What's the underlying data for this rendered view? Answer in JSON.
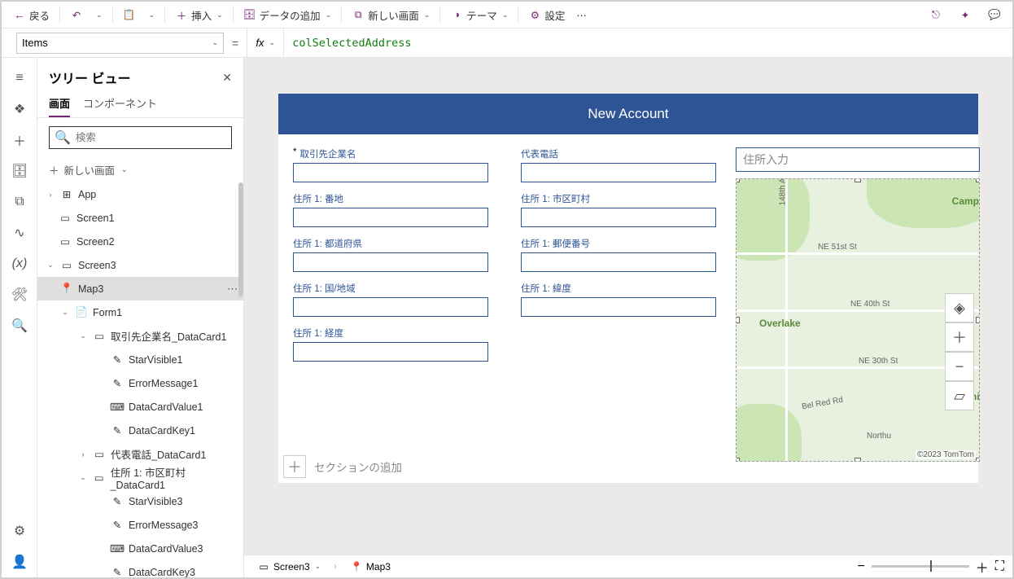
{
  "topbar": {
    "back": "戻る",
    "insert": "挿入",
    "add_data": "データの追加",
    "new_screen": "新しい画面",
    "theme": "テーマ",
    "settings": "設定"
  },
  "formula": {
    "property": "Items",
    "fx": "fx",
    "expression": "colSelectedAddress"
  },
  "tree": {
    "title": "ツリー ビュー",
    "tab_screen": "画面",
    "tab_components": "コンポーネント",
    "search_placeholder": "検索",
    "new_screen": "新しい画面",
    "items": {
      "app": "App",
      "screen1": "Screen1",
      "screen2": "Screen2",
      "screen3": "Screen3",
      "map3": "Map3",
      "form1": "Form1",
      "dc_company": "取引先企業名_DataCard1",
      "starvisible1": "StarVisible1",
      "errormessage1": "ErrorMessage1",
      "datacardvalue1": "DataCardValue1",
      "datacardkey1": "DataCardKey1",
      "dc_phone": "代表電話_DataCard1",
      "dc_city": "住所 1: 市区町村_DataCard1",
      "starvisible3": "StarVisible3",
      "errormessage3": "ErrorMessage3",
      "datacardvalue3": "DataCardValue3",
      "datacardkey3": "DataCardKey3"
    }
  },
  "screen": {
    "title": "New Account",
    "fields": {
      "company": "取引先企業名",
      "phone": "代表電話",
      "street": "住所 1: 番地",
      "city": "住所 1: 市区町村",
      "state": "住所 1: 都道府県",
      "postal": "住所 1: 郵便番号",
      "country": "住所 1: 国/地域",
      "latitude": "住所 1: 緯度",
      "longitude": "住所 1: 経度"
    },
    "address_input_placeholder": "住所入力",
    "add_section": "セクションの追加",
    "map": {
      "overlake": "Overlake",
      "campt": "Campt",
      "kenil": "Kenil",
      "r148": "148th A",
      "r51": "NE 51st St",
      "r40": "NE 40th St",
      "r30": "NE 30th St",
      "bel": "Bel Red Rd",
      "northu": "Northu",
      "attrib": "©2023 TomTom"
    }
  },
  "bottom": {
    "screen3": "Screen3",
    "map3": "Map3"
  }
}
